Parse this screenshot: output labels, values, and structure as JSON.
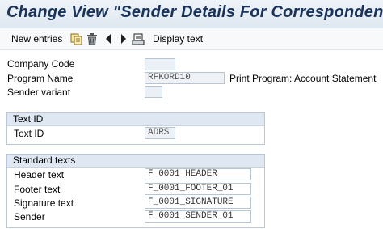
{
  "title": "Change View \"Sender Details For Correspondence\": D",
  "toolbar": {
    "new_entries": "New entries",
    "display_text": "Display text",
    "icons": [
      "copy-icon",
      "delete-icon",
      "previous-icon",
      "next-icon",
      "print-icon"
    ]
  },
  "header_fields": {
    "company_code": {
      "label": "Company Code",
      "value": ""
    },
    "program_name": {
      "label": "Program Name",
      "value": "RFKORD10",
      "description": "Print Program: Account Statement"
    },
    "sender_variant": {
      "label": "Sender variant",
      "value": ""
    }
  },
  "text_id_group": {
    "title": "Text ID",
    "label": "Text ID",
    "value": "ADRS"
  },
  "standard_texts": {
    "title": "Standard texts",
    "rows": [
      {
        "label": "Header text",
        "value": "F_0001_HEADER"
      },
      {
        "label": "Footer text",
        "value": "F_0001_FOOTER_01"
      },
      {
        "label": "Signature text",
        "value": "F_0001_SIGNATURE"
      },
      {
        "label": "Sender",
        "value": "F_0001_SENDER_01"
      }
    ]
  },
  "colors": {
    "title_text": "#19335a",
    "group_header": "#dfe8f2",
    "input_border": "#b7c6d5"
  }
}
